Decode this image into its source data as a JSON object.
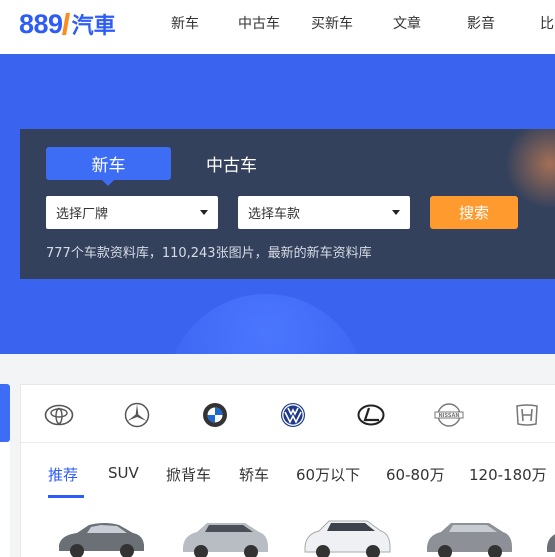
{
  "header": {
    "logo_number": "889",
    "logo_number_tail": "l",
    "logo_text": "汽車",
    "nav": [
      "新车",
      "中古车",
      "买新车",
      "文章",
      "影音",
      "比"
    ]
  },
  "search": {
    "tabs": [
      "新车",
      "中古车"
    ],
    "active_tab": "新车",
    "brand_select": "选择厂牌",
    "model_select": "选择车款",
    "search_button": "搜索",
    "stats_text": "777个车款资料库，110,243张图片，最新的新车资料库"
  },
  "brands": [
    "toyota-logo",
    "mercedes-logo",
    "bmw-logo",
    "vw-logo",
    "lexus-logo",
    "nissan-logo",
    "honda-logo"
  ],
  "categories": [
    "推荐",
    "SUV",
    "掀背车",
    "轿车",
    "60万以下",
    "60-80万",
    "120-180万"
  ],
  "active_category": "推荐",
  "colors": {
    "brand_blue": "#2d5cf6",
    "hero_blue": "#3a63f0",
    "panel_dark": "#34415c",
    "search_orange": "#ff9a2e"
  }
}
